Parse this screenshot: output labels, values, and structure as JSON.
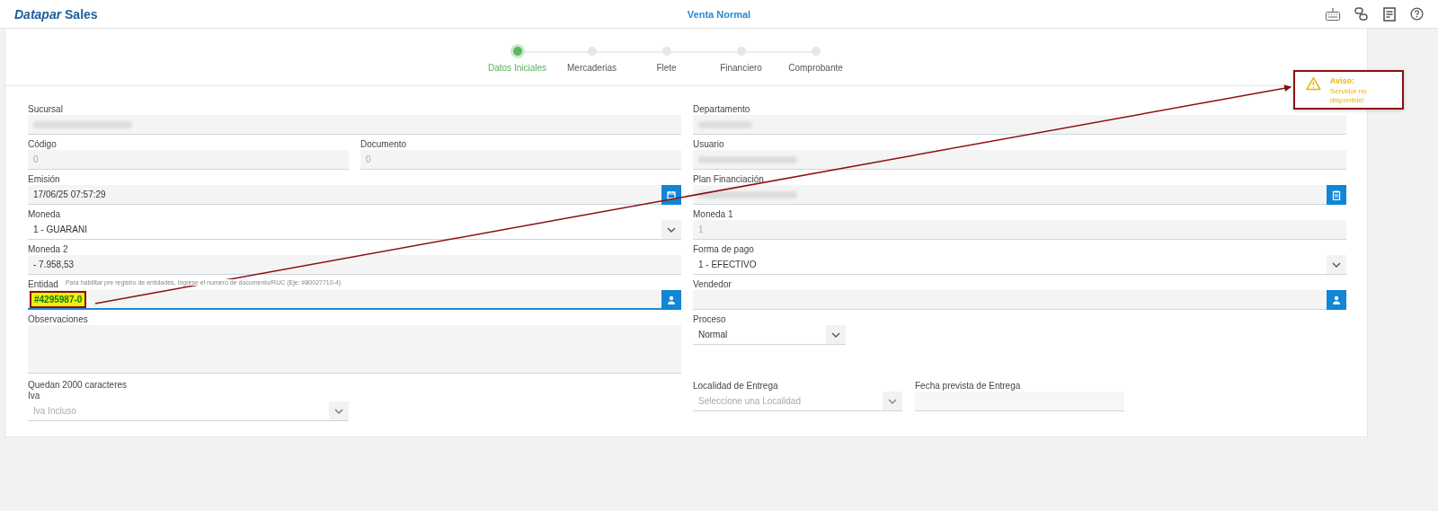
{
  "header": {
    "brand": "*Datapar* Sales",
    "title": "Venta Normal"
  },
  "steps": [
    {
      "label": "Datos Iniciales",
      "selected": true
    },
    {
      "label": "Mercaderias",
      "selected": false
    },
    {
      "label": "Flete",
      "selected": false
    },
    {
      "label": "Financiero",
      "selected": false
    },
    {
      "label": "Comprobante",
      "selected": false
    }
  ],
  "alert": {
    "title": "Aviso:",
    "message": "Servidor no disponible!",
    "annotated": true
  },
  "left": {
    "sucursal": {
      "label": "Sucursal",
      "redacted": true
    },
    "codigo": {
      "label": "Código",
      "value": "0",
      "disabled": true
    },
    "documento": {
      "label": "Documento",
      "value": "0",
      "disabled": true
    },
    "emision": {
      "label": "Emisión",
      "value": "17/06/25 07:57:29"
    },
    "moneda": {
      "label": "Moneda",
      "value": "1 - GUARANI"
    },
    "moneda2": {
      "label": "Moneda 2",
      "value": "- 7.958,53"
    },
    "entidad": {
      "label": "Entidad",
      "hint": "Para habilitar pre registro de entidades, Ingrese el numero de documento/RUC (Eje: #80027710-4)",
      "value": "#4295987-0",
      "focused": true,
      "annotated": true
    },
    "observaciones": {
      "label": "Observaciones"
    },
    "counter": "Quedan 2000 caracteres",
    "iva": {
      "label": "Iva",
      "value": "Iva Incluso",
      "disabled": true
    }
  },
  "right": {
    "departamento": {
      "label": "Departamento",
      "redacted": true
    },
    "usuario": {
      "label": "Usuario",
      "redacted": true
    },
    "plan": {
      "label": "Plan Financiación",
      "redacted": true
    },
    "moneda1": {
      "label": "Moneda 1",
      "value": "1",
      "disabled": true
    },
    "forma_pago": {
      "label": "Forma de pago",
      "value": "1 - EFECTIVO"
    },
    "vendedor": {
      "label": "Vendedor"
    },
    "proceso": {
      "label": "Proceso",
      "value": "Normal"
    },
    "localidad": {
      "label": "Localidad de Entrega",
      "placeholder": "Seleccione una Localidad"
    },
    "fecha": {
      "label": "Fecha prevista de Entrega"
    }
  }
}
